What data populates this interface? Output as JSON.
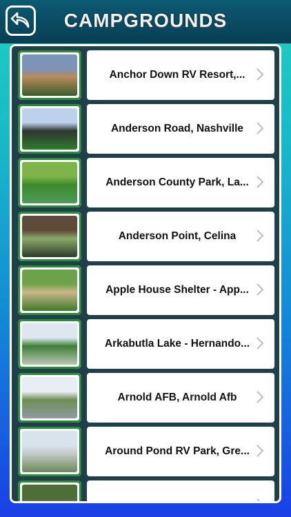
{
  "header": {
    "title": "CAMPGROUNDS",
    "back_icon": "back-arrow-icon"
  },
  "list": {
    "items": [
      {
        "label": "Anchor Down RV Resort,...",
        "thumb_colors": [
          "#7b94b8",
          "#b88a5a",
          "#3a5d2a"
        ]
      },
      {
        "label": "Anderson Road, Nashville",
        "thumb_colors": [
          "#bcd1ea",
          "#2f3433",
          "#2f7d2a"
        ]
      },
      {
        "label": "Anderson County Park, La...",
        "thumb_colors": [
          "#7fb44a",
          "#3d8a2b",
          "#4e9a5a"
        ]
      },
      {
        "label": "Anderson Point, Celina",
        "thumb_colors": [
          "#5d4a38",
          "#8aa86a",
          "#2e3a2a"
        ]
      },
      {
        "label": "Apple House Shelter - App...",
        "thumb_colors": [
          "#6ea24a",
          "#cbb68a",
          "#3f7a2b"
        ]
      },
      {
        "label": "Arkabutla Lake - Hernando...",
        "thumb_colors": [
          "#dde7ef",
          "#3f7f3a",
          "#b8c7b0"
        ]
      },
      {
        "label": "Arnold AFB, Arnold Afb",
        "thumb_colors": [
          "#e8eef4",
          "#6f8e55",
          "#8e9aa2"
        ]
      },
      {
        "label": "Around Pond RV Park, Gre...",
        "thumb_colors": [
          "#d8e3ec",
          "#c5c9c8",
          "#6a8a5a"
        ]
      },
      {
        "label": "",
        "thumb_colors": [
          "#4e6e38",
          "#a58a6a",
          "#9fb79a"
        ]
      }
    ]
  },
  "colors": {
    "accent_green": "#2c8a3b",
    "header": "#0c5a73",
    "panel": "#1f3f49"
  }
}
